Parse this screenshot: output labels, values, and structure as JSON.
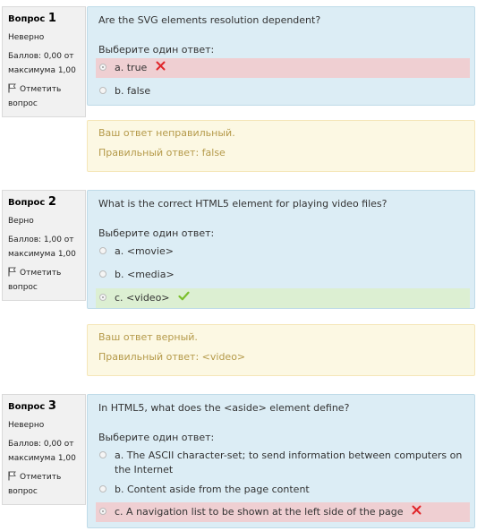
{
  "questions": [
    {
      "title_word": "Вопрос",
      "number": "1",
      "state": "Неверно",
      "grade_line1": "Баллов: 0,00 от",
      "grade_line2": "максимума 1,00",
      "flag_line1": "Отметить",
      "flag_line2": "вопрос",
      "text": "Are the SVG elements resolution dependent?",
      "prompt": "Выберите один ответ:",
      "answers": [
        {
          "label": "a. true",
          "status": "incorrect",
          "checked": true
        },
        {
          "label": "b. false",
          "status": "none",
          "checked": false
        }
      ],
      "feedback_line1": "Ваш ответ неправильный.",
      "feedback_line2": "Правильный ответ: false"
    },
    {
      "title_word": "Вопрос",
      "number": "2",
      "state": "Верно",
      "grade_line1": "Баллов: 1,00 от",
      "grade_line2": "максимума 1,00",
      "flag_line1": "Отметить",
      "flag_line2": "вопрос",
      "text": "What is the correct HTML5 element for playing video files?",
      "prompt": "Выберите один ответ:",
      "answers": [
        {
          "label": "a. <movie>",
          "status": "none",
          "checked": false
        },
        {
          "label": "b. <media>",
          "status": "none",
          "checked": false
        },
        {
          "label": "c. <video>",
          "status": "correct",
          "checked": true
        }
      ],
      "feedback_line1": "Ваш ответ верный.",
      "feedback_line2": "Правильный ответ: <video>"
    },
    {
      "title_word": "Вопрос",
      "number": "3",
      "state": "Неверно",
      "grade_line1": "Баллов: 0,00 от",
      "grade_line2": "максимума 1,00",
      "flag_line1": "Отметить",
      "flag_line2": "вопрос",
      "text": "In HTML5, what does the <aside> element define?",
      "prompt": "Выберите один ответ:",
      "answers": [
        {
          "label": "a. The ASCII character-set; to send information between computers on the Internet",
          "status": "none",
          "checked": false
        },
        {
          "label": "b. Content aside from the page content",
          "status": "none",
          "checked": false
        },
        {
          "label": "c. A navigation list to be shown at the left side of the page",
          "status": "incorrect",
          "checked": true
        }
      ]
    }
  ],
  "icons": {
    "incorrect_mark": "cross-icon",
    "correct_mark": "check-icon",
    "flag": "flag-icon"
  },
  "colors": {
    "incorrect_bg": "#efcfd2",
    "correct_bg": "#dcefd2",
    "question_bg": "#dcedf5",
    "feedback_bg": "#fcf8e3",
    "feedback_text": "#b59a4a",
    "cross": "#e0262b",
    "check": "#7bbf2b"
  }
}
